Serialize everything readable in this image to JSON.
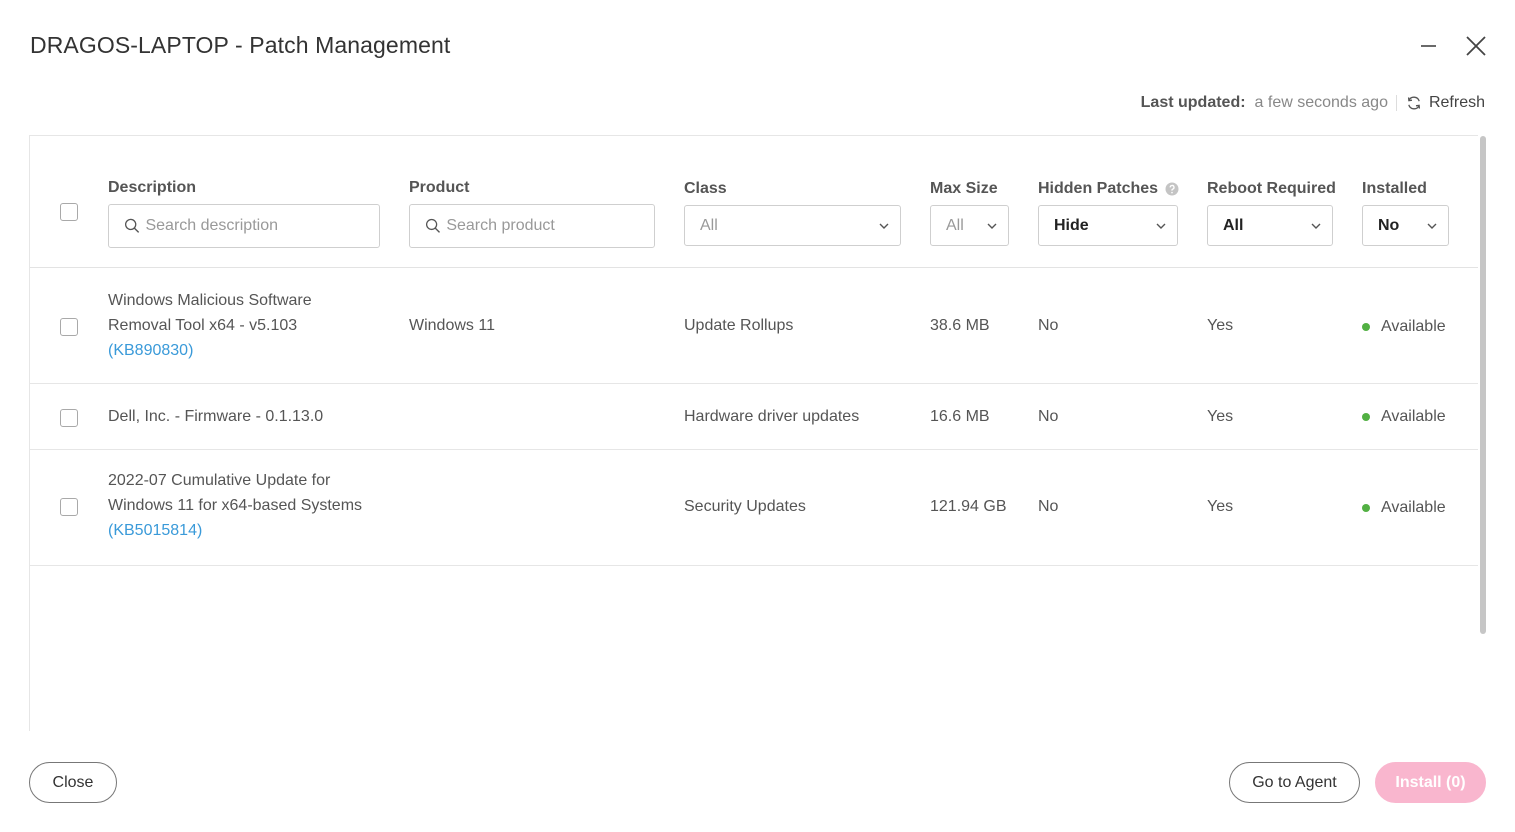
{
  "dialog": {
    "title": "DRAGOS-LAPTOP - Patch Management",
    "last_updated_label": "Last updated:",
    "last_updated_value": "a few seconds ago",
    "refresh_label": "Refresh"
  },
  "columns": {
    "description": "Description",
    "product": "Product",
    "class": "Class",
    "max_size": "Max Size",
    "hidden_patches": "Hidden Patches",
    "reboot_required": "Reboot Required",
    "installed": "Installed"
  },
  "filters": {
    "description_placeholder": "Search description",
    "product_placeholder": "Search product",
    "class_value": "All",
    "max_size_value": "All",
    "hidden_patches_value": "Hide",
    "reboot_required_value": "All",
    "installed_value": "No"
  },
  "rows": [
    {
      "description_line1": "Windows Malicious Software",
      "description_line2": "Removal Tool x64 - v5.103",
      "kb": "(KB890830)",
      "product": "Windows 11",
      "class": "Update Rollups",
      "size": "38.6 MB",
      "hidden": "No",
      "reboot": "Yes",
      "status": "Available"
    },
    {
      "description_line1": "Dell, Inc. - Firmware - 0.1.13.0",
      "product": "",
      "class": "Hardware driver updates",
      "size": "16.6 MB",
      "hidden": "No",
      "reboot": "Yes",
      "status": "Available"
    },
    {
      "description_line1": "2022-07 Cumulative Update for",
      "description_line2": "Windows 11 for x64-based Systems",
      "kb": "(KB5015814)",
      "product": "",
      "class": "Security Updates",
      "size": "121.94 GB",
      "hidden": "No",
      "reboot": "Yes",
      "status": "Available"
    }
  ],
  "footer": {
    "close_label": "Close",
    "go_to_agent_label": "Go to Agent",
    "install_label": "Install (0)"
  },
  "colors": {
    "link": "#3a9ad9",
    "status_available": "#52b043",
    "install_disabled": "#f9b6ce"
  }
}
